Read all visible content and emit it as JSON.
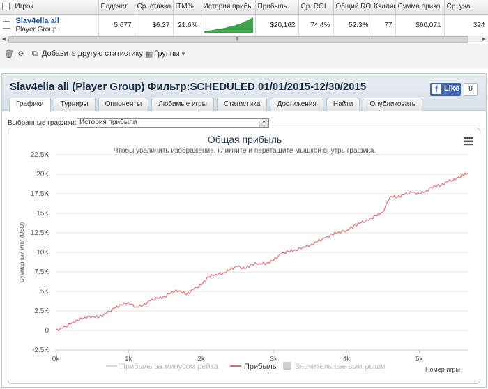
{
  "grid": {
    "columns": [
      "",
      "Игрок",
      "Подсчет",
      "Ср. ставка",
      "ITM%",
      "История прибы",
      "Прибыль",
      "Ср. ROI",
      "Общий ROI",
      "Квалиф",
      "Сумма призо",
      "Ср. уча"
    ],
    "row": {
      "player_name": "Slav4ella all",
      "player_group": "Player Group",
      "count": "5,677",
      "avg_stake": "$6.37",
      "itm": "21.6%",
      "profit": "$20,162",
      "avg_roi": "74.4%",
      "total_roi": "52.3%",
      "qualif": "77",
      "prize_sum": "$60,071",
      "avg_entrants": "324"
    }
  },
  "toolbar": {
    "add_stats": "Добавить другую статистику",
    "groups": "Группы"
  },
  "panel": {
    "title": "Slav4ella all (Player Group) Фильтр:SCHEDULED 01/01/2015-12/30/2015",
    "fb_like": "Like",
    "fb_count": "0",
    "tabs": [
      "Графики",
      "Турниры",
      "Оппоненты",
      "Любимые игры",
      "Статистика",
      "Достижения",
      "Найти",
      "Опубликовать"
    ],
    "select_label": "Выбранные графики:",
    "select_value": "История прибыли"
  },
  "chart_data": {
    "type": "line",
    "title": "Общая прибыль",
    "subtitle": "Чтобы увеличить изображение, кликните и перетащите мышкой внутрь графика.",
    "ylabel": "Суммарный итог (USD)",
    "xlabel": "Номер игры",
    "xlim": [
      0,
      5677
    ],
    "ylim": [
      -2500,
      22500
    ],
    "x_ticks": [
      "0k",
      "1k",
      "2k",
      "3k",
      "4k",
      "5k"
    ],
    "y_ticks": [
      "-2.5K",
      "0",
      "2.5K",
      "5K",
      "7.5K",
      "10K",
      "12.5K",
      "15K",
      "17.5K",
      "20K",
      "22.5K"
    ],
    "legend_position": "bottom",
    "legend": [
      "Прибыль за минусом рейка",
      "Прибыль",
      "Значительные выигрыши"
    ],
    "series": [
      {
        "name": "Прибыль",
        "color": "#d96b6b",
        "points": [
          [
            0,
            0
          ],
          [
            100,
            300
          ],
          [
            200,
            800
          ],
          [
            300,
            1300
          ],
          [
            400,
            1700
          ],
          [
            500,
            1800
          ],
          [
            600,
            1700
          ],
          [
            700,
            2200
          ],
          [
            800,
            2800
          ],
          [
            900,
            3300
          ],
          [
            1000,
            3600
          ],
          [
            1100,
            3000
          ],
          [
            1200,
            3200
          ],
          [
            1300,
            3800
          ],
          [
            1400,
            4100
          ],
          [
            1500,
            4300
          ],
          [
            1600,
            5000
          ],
          [
            1700,
            5100
          ],
          [
            1800,
            4600
          ],
          [
            1900,
            5300
          ],
          [
            2000,
            5800
          ],
          [
            2100,
            6900
          ],
          [
            2200,
            7200
          ],
          [
            2300,
            7300
          ],
          [
            2400,
            7800
          ],
          [
            2500,
            8200
          ],
          [
            2600,
            7900
          ],
          [
            2700,
            8500
          ],
          [
            2800,
            8600
          ],
          [
            2900,
            8600
          ],
          [
            3000,
            9000
          ],
          [
            3100,
            9800
          ],
          [
            3200,
            10100
          ],
          [
            3300,
            10300
          ],
          [
            3400,
            10700
          ],
          [
            3500,
            10900
          ],
          [
            3600,
            11400
          ],
          [
            3700,
            11800
          ],
          [
            3800,
            12300
          ],
          [
            3900,
            12600
          ],
          [
            4000,
            12800
          ],
          [
            4100,
            13400
          ],
          [
            4200,
            13800
          ],
          [
            4300,
            14100
          ],
          [
            4400,
            14700
          ],
          [
            4500,
            15200
          ],
          [
            4600,
            17200
          ],
          [
            4700,
            17100
          ],
          [
            4800,
            17400
          ],
          [
            4900,
            17700
          ],
          [
            5000,
            17500
          ],
          [
            5100,
            17900
          ],
          [
            5200,
            18500
          ],
          [
            5300,
            18600
          ],
          [
            5400,
            19100
          ],
          [
            5500,
            19300
          ],
          [
            5600,
            19900
          ],
          [
            5677,
            20162
          ]
        ]
      }
    ],
    "grid": true
  }
}
